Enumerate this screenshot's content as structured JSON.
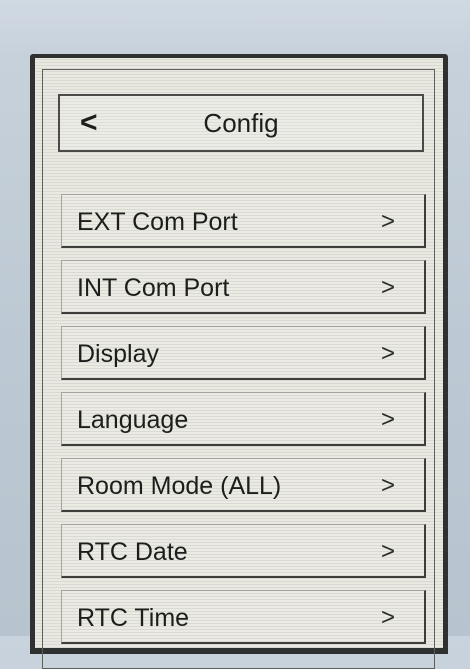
{
  "header": {
    "back_symbol": "<",
    "title": "Config"
  },
  "menu": {
    "chevron_symbol": ">",
    "items": [
      {
        "label": "EXT Com Port"
      },
      {
        "label": "INT Com Port"
      },
      {
        "label": "Display"
      },
      {
        "label": "Language"
      },
      {
        "label": "Room Mode (ALL)"
      },
      {
        "label": "RTC Date"
      },
      {
        "label": "RTC Time"
      }
    ]
  }
}
